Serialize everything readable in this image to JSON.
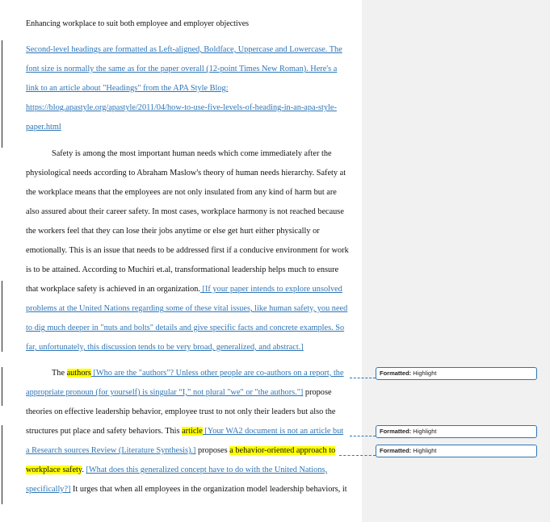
{
  "document": {
    "title": "Enhancing workplace to suit both employee and employer objectives",
    "heading_note": [
      "Second-level headings are formatted as Left-aligned, Boldface, Uppercase and Lowercase.   The",
      "font size is normally the same as for the paper overall (12-point Times New Roman).  Here's a",
      "link to an article about \"Headings\" from the APA Style Blog:",
      "https://blog.apastyle.org/apastyle/2011/04/how-to-use-five-levels-of-heading-in-an-apa-style-",
      "paper.html"
    ],
    "para1": {
      "lines": [
        "Safety is among the most important human needs which come immediately after the",
        "physiological needs according to Abraham Maslow's theory of human needs hierarchy. Safety at",
        "the workplace means that the employees are not only insulated from any kind of harm but are",
        "also assured about their career safety. In most cases, workplace harmony is not reached because",
        "the workers feel that they can lose their jobs anytime or else get hurt either physically or",
        "emotionally. This is an issue that needs to be addressed first if a conducive environment for work",
        "is to be attained. According to Muchiri et.al, transformational leadership helps much to ensure"
      ],
      "line8_text": "that workplace safety is achieved in an organization.",
      "line8_comment": " [If your paper intends to explore unsolved",
      "comment_lines": [
        "problems at the United Nations regarding some of these vital issues, like human safety, you need",
        "to dig much deeper in \"nuts and bolts\" details and give specific facts and concrete examples.  So",
        "far, unfortunately, this discussion tends to be very broad, generalized, and abstract.]"
      ]
    },
    "para2": {
      "l1_text": "The ",
      "l1_hl": "authors",
      "l1_comment": " [Who are the \"authors\"?  Unless other people are co-authors on a report, the",
      "l2_comment": "appropriate pronoun (for yourself) is singular “I,” not plural \"we\" or \"the authors.\"]",
      "l2_text": " propose",
      "l3": "theories on effective leadership behavior, employee trust to not only their leaders but also the",
      "l4_text": "structures put place and safety behaviors. This ",
      "l4_hl": "article",
      "l4_comment": " [Your WA2 document is not an article but",
      "l5_comment": "a Research sources Review (Literature Synthesis).]",
      "l5_text": " proposes ",
      "l5_hl": "a behavior-oriented approach to",
      "l6_hl": "workplace safety",
      "l6_text": ". ",
      "l6_comment": "[What does this generalized concept have to do with the United Nations,",
      "l7_comment": "specifically?]",
      "l7_text": "  It urges that when all employees in the organization model leadership behaviors, it"
    }
  },
  "comments": [
    {
      "label": "Formatted:",
      "value": "Highlight"
    },
    {
      "label": "Formatted:",
      "value": "Highlight"
    },
    {
      "label": "Formatted:",
      "value": "Highlight"
    }
  ],
  "colors": {
    "revision": "#2e75b6",
    "highlight": "#ffff00",
    "margin_pane": "#f1f1f1"
  }
}
